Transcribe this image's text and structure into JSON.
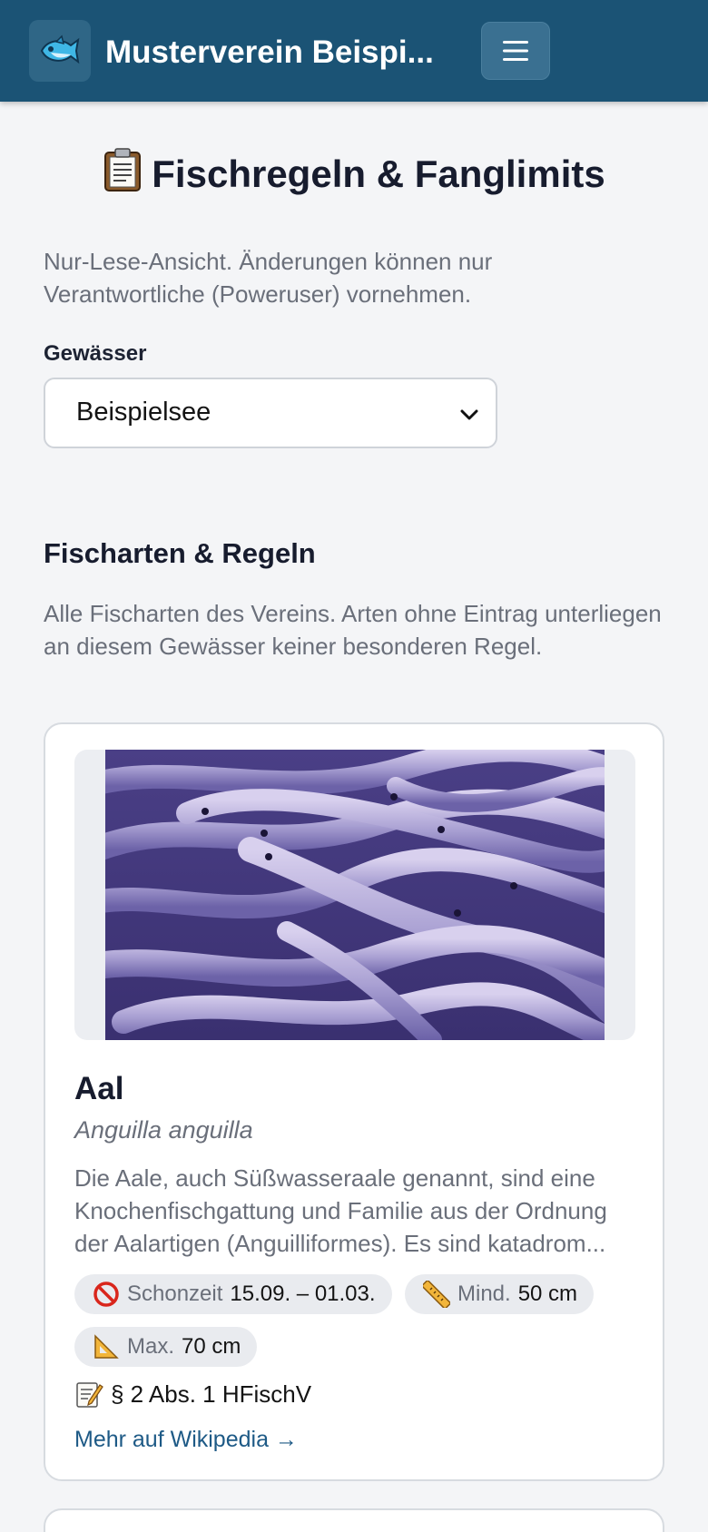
{
  "header": {
    "title": "Musterverein Beispi...",
    "logo_icon": "fish-icon",
    "menu_icon": "hamburger-icon",
    "bg_color": "#1b5375"
  },
  "page": {
    "title_icon": "clipboard-icon",
    "title": "Fischregeln & Fanglimits",
    "readonly_note": "Nur-Lese-Ansicht. Änderungen können nur Verantwortliche (Poweruser) vornehmen."
  },
  "water_select": {
    "label": "Gewässer",
    "selected": "Beispielsee"
  },
  "section": {
    "title": "Fischarten & Regeln",
    "description": "Alle Fischarten des Vereins. Arten ohne Eintrag unterliegen an diesem Gewässer keiner besonderen Regel."
  },
  "cards": [
    {
      "name": "Aal",
      "latin": "Anguilla anguilla",
      "description": "Die Aale, auch Süßwasseraale genannt, sind eine Knochenfischgattung und Familie aus der Ordnung der Aalartigen (Anguilliformes). Es sind katadrom...",
      "closed_season_label": "Schonzeit",
      "closed_season_value": "15.09. – 01.03.",
      "min_label": "Mind.",
      "min_value": "50 cm",
      "max_label": "Max.",
      "max_value": "70 cm",
      "regulation": "§ 2 Abs. 1 HFischV",
      "wiki_link": "Mehr auf Wikipedia →"
    }
  ]
}
